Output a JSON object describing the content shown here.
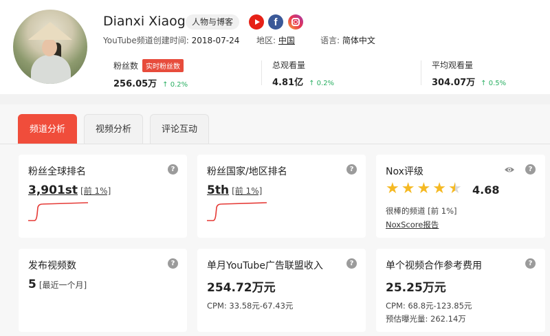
{
  "channel": {
    "name": "Dianxi Xiaoge",
    "category": "人物与博客",
    "created_label": "YouTube频道创建时间: ",
    "created_value": "2018-07-24",
    "region_label": "地区: ",
    "region_value": "中国",
    "language_label": "语言: ",
    "language_value": "简体中文"
  },
  "social": [
    "youtube-icon",
    "facebook-icon",
    "instagram-icon"
  ],
  "stats": {
    "subscribers": {
      "label": "粉丝数",
      "badge": "实时粉丝数",
      "value": "256.05万",
      "change": "0.2%"
    },
    "total_views": {
      "label": "总观看量",
      "value": "4.81亿",
      "change": "0.2%"
    },
    "avg_views": {
      "label": "平均观看量",
      "value": "304.07万",
      "change": "0.5%"
    }
  },
  "tabs": [
    {
      "label": "频道分析",
      "active": true
    },
    {
      "label": "视频分析",
      "active": false
    },
    {
      "label": "评论互动",
      "active": false
    }
  ],
  "cards": {
    "global_rank": {
      "title": "粉丝全球排名",
      "value": "3,901st",
      "sub": "[前 1%]"
    },
    "country_rank": {
      "title": "粉丝国家/地区排名",
      "value": "5th",
      "sub": "[前 1%]"
    },
    "nox": {
      "title": "Nox评级",
      "score": "4.68",
      "rating": 4.68,
      "desc": "很棒的频道 [前 1%]",
      "link": "NoxScore报告"
    },
    "videos": {
      "title": "发布视频数",
      "value": "5",
      "sub": "[最近一个月]"
    },
    "revenue": {
      "title": "单月YouTube广告联盟收入",
      "value": "254.72万元",
      "cpm": "CPM: 33.58元-67.43元"
    },
    "cost": {
      "title": "单个视频合作参考费用",
      "value": "25.25万元",
      "cpm": "CPM: 68.8元-123.85元",
      "exposure": "预估曝光量: 262.14万"
    }
  },
  "help_symbol": "?",
  "arrow_up": "↑",
  "colors": {
    "accent": "#f04d3b",
    "up": "#27ae60",
    "star": "#f5b923"
  }
}
